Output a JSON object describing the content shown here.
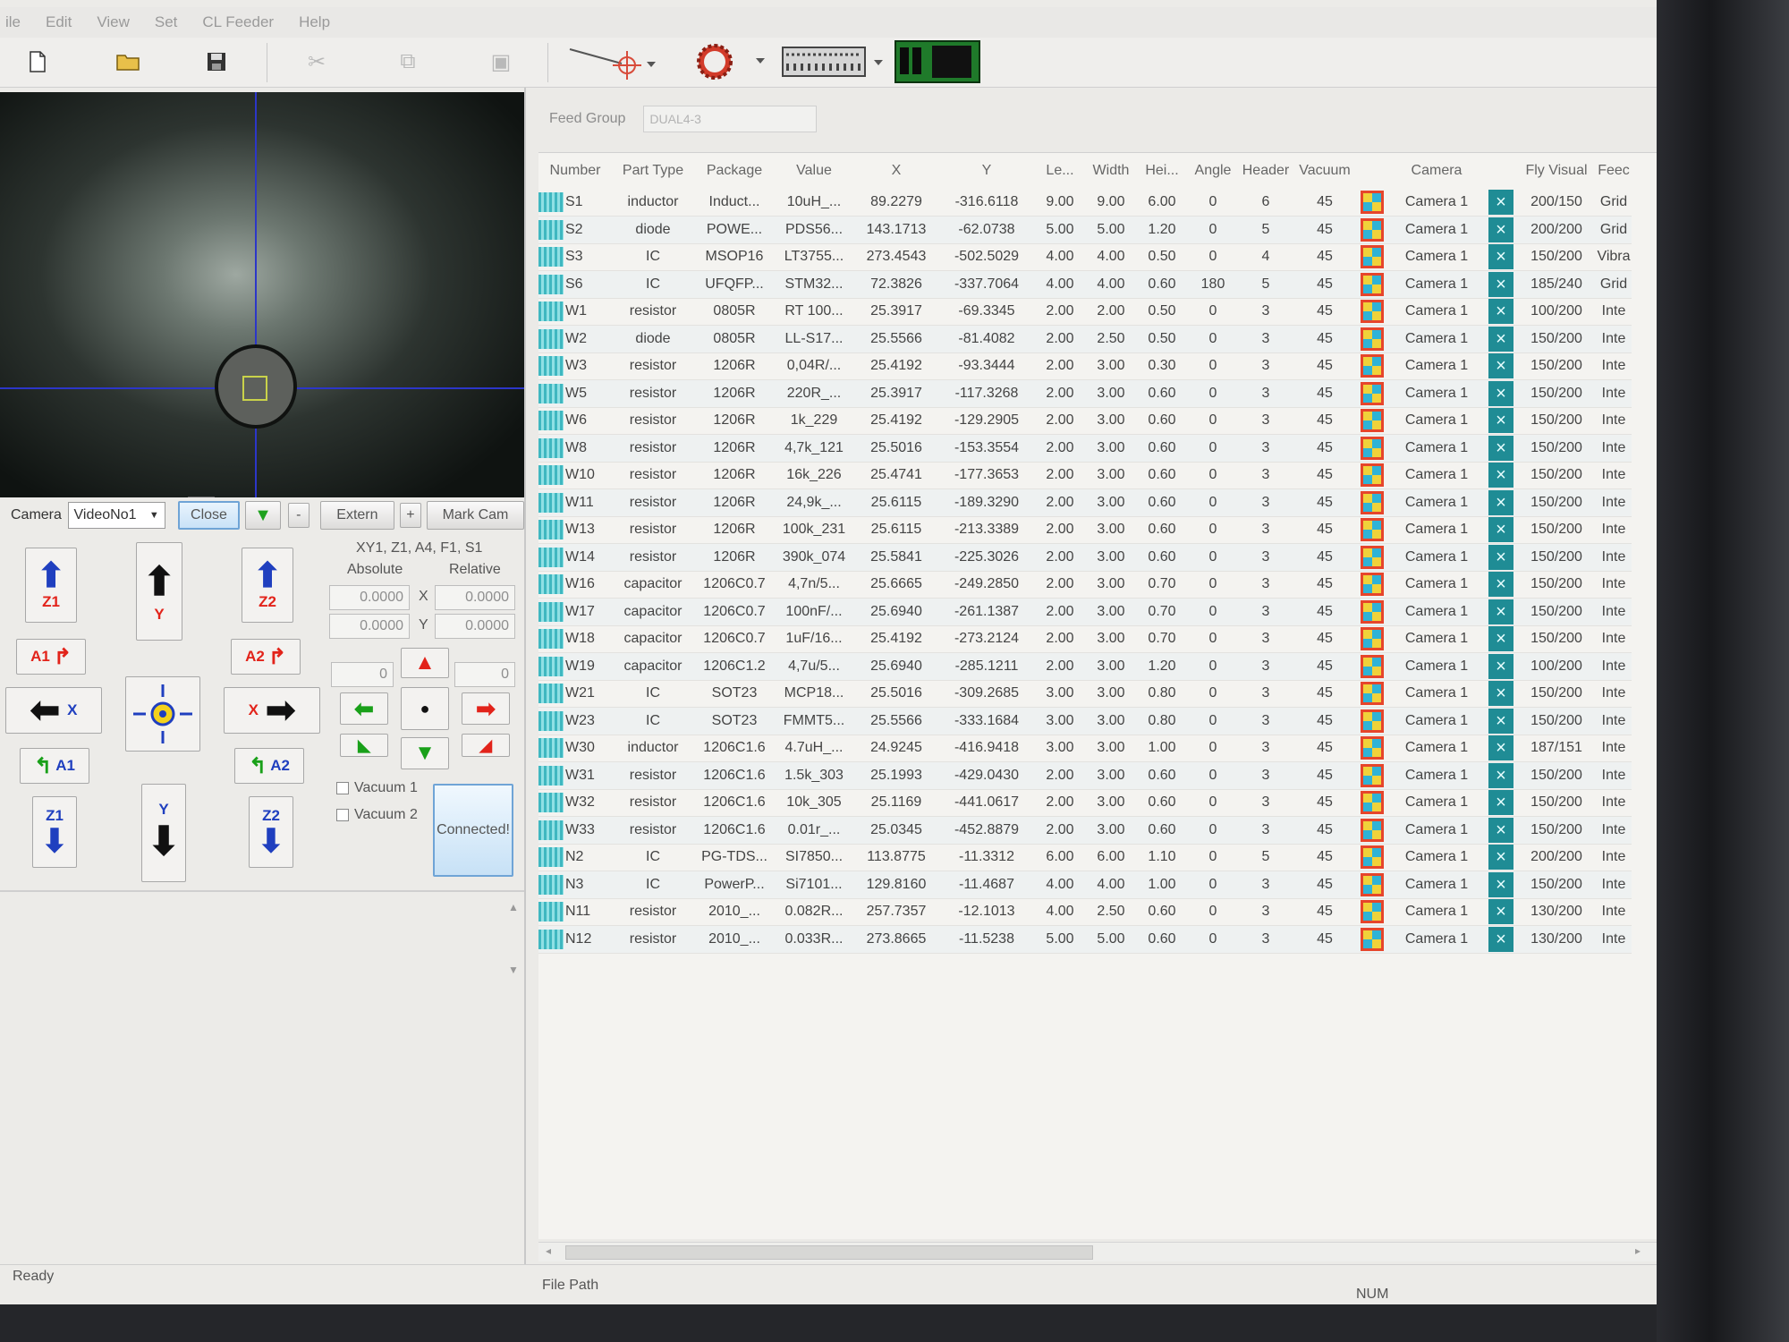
{
  "menu": [
    "ile",
    "Edit",
    "View",
    "Set",
    "CL Feeder",
    "Help"
  ],
  "toolbar": {
    "icons": [
      "new-file-icon",
      "open-folder-icon",
      "save-icon",
      "cut-icon",
      "copy-icon",
      "paste-icon",
      "crosshair-icon",
      "gear-icon",
      "feeder-strip-icon",
      "pcb-board-icon"
    ]
  },
  "camera_row": {
    "label": "Camera",
    "select_value": "VideoNo1",
    "close": "Close",
    "minus": "-",
    "extern": "Extern",
    "plus": "+",
    "mark_cam": "Mark Cam"
  },
  "jog": {
    "z1_up": "Z1",
    "y_up": "Y",
    "z2_up": "Z2",
    "a1_rot": "A1",
    "a2_rot": "A2",
    "x_left": "X",
    "x_right": "X",
    "a1_rot2": "A1",
    "a2_rot2": "A2",
    "z1_down": "Z1",
    "y_down": "Y",
    "z2_down": "Z2",
    "axes_title": "XY1, Z1, A4, F1, S1",
    "absolute": "Absolute",
    "relative": "Relative",
    "abs_x": "0.0000",
    "rel_x": "0.0000",
    "abs_y": "0.0000",
    "rel_y": "0.0000",
    "x_label": "X",
    "y_label": "Y",
    "step_left": "0",
    "step_right": "0",
    "vacuum1": "Vacuum 1",
    "vacuum2": "Vacuum 2",
    "connected": "Connected!"
  },
  "feed_group": {
    "label": "Feed Group",
    "value": "DUAL4-3"
  },
  "columns": [
    "Number",
    "Part Type",
    "Package",
    "Value",
    "X",
    "Y",
    "Le...",
    "Width",
    "Hei...",
    "Angle",
    "Header",
    "Vacuum",
    "",
    "Camera",
    "",
    "Fly Visual",
    "Feec"
  ],
  "rows": [
    [
      "S1",
      "inductor",
      "Induct...",
      "10uH_...",
      "89.2279",
      "-316.6118",
      "9.00",
      "9.00",
      "6.00",
      "0",
      "6",
      "45",
      "Camera 1",
      "200/150",
      "Grid"
    ],
    [
      "S2",
      "diode",
      "POWE...",
      "PDS56...",
      "143.1713",
      "-62.0738",
      "5.00",
      "5.00",
      "1.20",
      "0",
      "5",
      "45",
      "Camera 1",
      "200/200",
      "Grid"
    ],
    [
      "S3",
      "IC",
      "MSOP16",
      "LT3755...",
      "273.4543",
      "-502.5029",
      "4.00",
      "4.00",
      "0.50",
      "0",
      "4",
      "45",
      "Camera 1",
      "150/200",
      "Vibra"
    ],
    [
      "S6",
      "IC",
      "UFQFP...",
      "STM32...",
      "72.3826",
      "-337.7064",
      "4.00",
      "4.00",
      "0.60",
      "180",
      "5",
      "45",
      "Camera 1",
      "185/240",
      "Grid"
    ],
    [
      "W1",
      "resistor",
      "0805R",
      "RT 100...",
      "25.3917",
      "-69.3345",
      "2.00",
      "2.00",
      "0.50",
      "0",
      "3",
      "45",
      "Camera 1",
      "100/200",
      "Inte"
    ],
    [
      "W2",
      "diode",
      "0805R",
      "LL-S17...",
      "25.5566",
      "-81.4082",
      "2.00",
      "2.50",
      "0.50",
      "0",
      "3",
      "45",
      "Camera 1",
      "150/200",
      "Inte"
    ],
    [
      "W3",
      "resistor",
      "1206R",
      "0,04R/...",
      "25.4192",
      "-93.3444",
      "2.00",
      "3.00",
      "0.30",
      "0",
      "3",
      "45",
      "Camera 1",
      "150/200",
      "Inte"
    ],
    [
      "W5",
      "resistor",
      "1206R",
      "220R_...",
      "25.3917",
      "-117.3268",
      "2.00",
      "3.00",
      "0.60",
      "0",
      "3",
      "45",
      "Camera 1",
      "150/200",
      "Inte"
    ],
    [
      "W6",
      "resistor",
      "1206R",
      "1k_229",
      "25.4192",
      "-129.2905",
      "2.00",
      "3.00",
      "0.60",
      "0",
      "3",
      "45",
      "Camera 1",
      "150/200",
      "Inte"
    ],
    [
      "W8",
      "resistor",
      "1206R",
      "4,7k_121",
      "25.5016",
      "-153.3554",
      "2.00",
      "3.00",
      "0.60",
      "0",
      "3",
      "45",
      "Camera 1",
      "150/200",
      "Inte"
    ],
    [
      "W10",
      "resistor",
      "1206R",
      "16k_226",
      "25.4741",
      "-177.3653",
      "2.00",
      "3.00",
      "0.60",
      "0",
      "3",
      "45",
      "Camera 1",
      "150/200",
      "Inte"
    ],
    [
      "W11",
      "resistor",
      "1206R",
      "24,9k_...",
      "25.6115",
      "-189.3290",
      "2.00",
      "3.00",
      "0.60",
      "0",
      "3",
      "45",
      "Camera 1",
      "150/200",
      "Inte"
    ],
    [
      "W13",
      "resistor",
      "1206R",
      "100k_231",
      "25.6115",
      "-213.3389",
      "2.00",
      "3.00",
      "0.60",
      "0",
      "3",
      "45",
      "Camera 1",
      "150/200",
      "Inte"
    ],
    [
      "W14",
      "resistor",
      "1206R",
      "390k_074",
      "25.5841",
      "-225.3026",
      "2.00",
      "3.00",
      "0.60",
      "0",
      "3",
      "45",
      "Camera 1",
      "150/200",
      "Inte"
    ],
    [
      "W16",
      "capacitor",
      "1206C0.7",
      "4,7n/5...",
      "25.6665",
      "-249.2850",
      "2.00",
      "3.00",
      "0.70",
      "0",
      "3",
      "45",
      "Camera 1",
      "150/200",
      "Inte"
    ],
    [
      "W17",
      "capacitor",
      "1206C0.7",
      "100nF/...",
      "25.6940",
      "-261.1387",
      "2.00",
      "3.00",
      "0.70",
      "0",
      "3",
      "45",
      "Camera 1",
      "150/200",
      "Inte"
    ],
    [
      "W18",
      "capacitor",
      "1206C0.7",
      "1uF/16...",
      "25.4192",
      "-273.2124",
      "2.00",
      "3.00",
      "0.70",
      "0",
      "3",
      "45",
      "Camera 1",
      "150/200",
      "Inte"
    ],
    [
      "W19",
      "capacitor",
      "1206C1.2",
      "4,7u/5...",
      "25.6940",
      "-285.1211",
      "2.00",
      "3.00",
      "1.20",
      "0",
      "3",
      "45",
      "Camera 1",
      "100/200",
      "Inte"
    ],
    [
      "W21",
      "IC",
      "SOT23",
      "MCP18...",
      "25.5016",
      "-309.2685",
      "3.00",
      "3.00",
      "0.80",
      "0",
      "3",
      "45",
      "Camera 1",
      "150/200",
      "Inte"
    ],
    [
      "W23",
      "IC",
      "SOT23",
      "FMMT5...",
      "25.5566",
      "-333.1684",
      "3.00",
      "3.00",
      "0.80",
      "0",
      "3",
      "45",
      "Camera 1",
      "150/200",
      "Inte"
    ],
    [
      "W30",
      "inductor",
      "1206C1.6",
      "4.7uH_...",
      "24.9245",
      "-416.9418",
      "3.00",
      "3.00",
      "1.00",
      "0",
      "3",
      "45",
      "Camera 1",
      "187/151",
      "Inte"
    ],
    [
      "W31",
      "resistor",
      "1206C1.6",
      "1.5k_303",
      "25.1993",
      "-429.0430",
      "2.00",
      "3.00",
      "0.60",
      "0",
      "3",
      "45",
      "Camera 1",
      "150/200",
      "Inte"
    ],
    [
      "W32",
      "resistor",
      "1206C1.6",
      "10k_305",
      "25.1169",
      "-441.0617",
      "2.00",
      "3.00",
      "0.60",
      "0",
      "3",
      "45",
      "Camera 1",
      "150/200",
      "Inte"
    ],
    [
      "W33",
      "resistor",
      "1206C1.6",
      "0.01r_...",
      "25.0345",
      "-452.8879",
      "2.00",
      "3.00",
      "0.60",
      "0",
      "3",
      "45",
      "Camera 1",
      "150/200",
      "Inte"
    ],
    [
      "N2",
      "IC",
      "PG-TDS...",
      "SI7850...",
      "113.8775",
      "-11.3312",
      "6.00",
      "6.00",
      "1.10",
      "0",
      "5",
      "45",
      "Camera 1",
      "200/200",
      "Inte"
    ],
    [
      "N3",
      "IC",
      "PowerP...",
      "Si7101...",
      "129.8160",
      "-11.4687",
      "4.00",
      "4.00",
      "1.00",
      "0",
      "3",
      "45",
      "Camera 1",
      "150/200",
      "Inte"
    ],
    [
      "N11",
      "resistor",
      "2010_...",
      "0.082R...",
      "257.7357",
      "-12.1013",
      "4.00",
      "2.50",
      "0.60",
      "0",
      "3",
      "45",
      "Camera 1",
      "130/200",
      "Inte"
    ],
    [
      "N12",
      "resistor",
      "2010_...",
      "0.033R...",
      "273.8665",
      "-11.5238",
      "5.00",
      "5.00",
      "0.60",
      "0",
      "3",
      "45",
      "Camera 1",
      "130/200",
      "Inte"
    ]
  ],
  "status": {
    "ready": "Ready",
    "file_path": "File Path",
    "num": "NUM"
  }
}
